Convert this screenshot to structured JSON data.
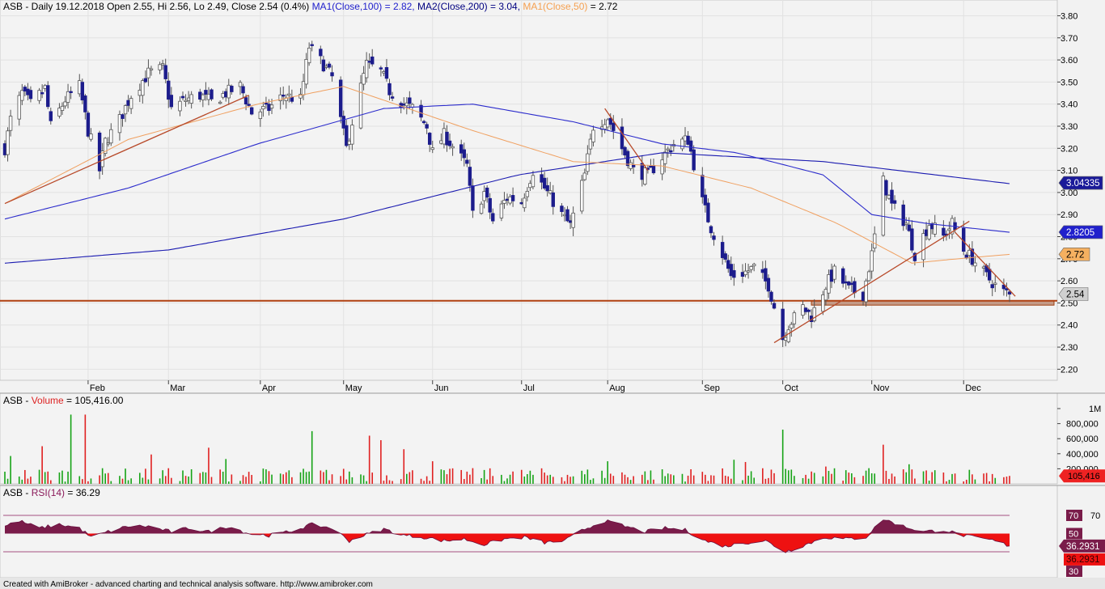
{
  "symbol": "ASB",
  "footer": "Created with AmiBroker - advanced charting and technical analysis software. http://www.amibroker.com",
  "colors": {
    "bull": "#16a316",
    "bear": "#e02020",
    "candle_bear": "#1c1c8c",
    "candle_bull_fill": "#ffffff",
    "ma100": "#2c2ccc",
    "ma200": "#f0a050",
    "ma50": "#f5a050",
    "rsi_up": "#7a1c4a",
    "rsi_down": "#ee1111",
    "trendline": "#b84a2a",
    "support": "#b04010"
  },
  "price_panel": {
    "title_parts": [
      {
        "text": "ASB - Daily 19.12.2018 Open 2.55, Hi 2.56, Lo 2.49, Close 2.54 (0.4%) ",
        "color": "#000000"
      },
      {
        "text": "MA1(Close,100) = 2.82, ",
        "color": "#2020cc"
      },
      {
        "text": "MA2(Close,200) = 3.04, ",
        "color": "#000080"
      },
      {
        "text": "MA1(Close,50)",
        "color": "#f5a050"
      },
      {
        "text": " = 2.72",
        "color": "#000000"
      }
    ],
    "y_ticks": [
      "3.80",
      "3.70",
      "3.60",
      "3.50",
      "3.40",
      "3.30",
      "3.20",
      "3.10",
      "3.00",
      "2.90",
      "2.80",
      "2.70",
      "2.60",
      "2.50",
      "2.40",
      "2.30",
      "2.20"
    ],
    "markers": [
      {
        "label": "3.04335",
        "value": 3.04335,
        "bg": "#1a1a99",
        "fg": "#ffffff"
      },
      {
        "label": "2.8205",
        "value": 2.8205,
        "bg": "#2020cc",
        "fg": "#ffffff"
      },
      {
        "label": "2.72",
        "value": 2.72,
        "bg": "#f5b060",
        "fg": "#000000"
      },
      {
        "label": "2.54",
        "value": 2.54,
        "bg": "#d0d0d0",
        "fg": "#000000"
      }
    ],
    "months": [
      "Feb",
      "Mar",
      "Apr",
      "May",
      "Jun",
      "Jul",
      "Aug",
      "Sep",
      "Oct",
      "Nov",
      "Dec"
    ]
  },
  "volume_panel": {
    "title_parts": [
      {
        "text": "ASB - ",
        "color": "#000000"
      },
      {
        "text": "Volume",
        "color": "#dd2222"
      },
      {
        "text": " = 105,416.00",
        "color": "#000000"
      }
    ],
    "y_ticks": [
      "1M",
      "800,000",
      "600,000",
      "400,000",
      "200,000"
    ],
    "marker": {
      "label": "105,416",
      "bg": "#ee2222",
      "fg": "#000000"
    }
  },
  "rsi_panel": {
    "title_parts": [
      {
        "text": "ASB - ",
        "color": "#000000"
      },
      {
        "text": "RSI(14)",
        "color": "#8a1a5a"
      },
      {
        "text": " = 36.29",
        "color": "#000000"
      }
    ],
    "levels": [
      "70",
      "50",
      "30"
    ],
    "tick_70": "70",
    "marker_top": "36.2931",
    "marker_bottom": "36.2931"
  },
  "chart_data": {
    "type": "candlestick",
    "title": "ASB - Daily 19.12.2018 Open 2.55, Hi 2.56, Lo 2.49, Close 2.54 (0.4%)",
    "ylim": [
      2.15,
      3.82
    ],
    "support_level": 2.51,
    "support_zone": [
      2.49,
      2.51
    ],
    "price_anchors": [
      [
        "2018-01-03",
        3.2
      ],
      [
        "2018-01-05",
        3.33
      ],
      [
        "2018-01-09",
        3.45
      ],
      [
        "2018-01-12",
        3.4
      ],
      [
        "2018-01-17",
        3.47
      ],
      [
        "2018-01-19",
        3.3
      ],
      [
        "2018-01-24",
        3.42
      ],
      [
        "2018-01-29",
        3.48
      ],
      [
        "2018-02-01",
        3.28
      ],
      [
        "2018-02-05",
        3.1
      ],
      [
        "2018-02-07",
        3.23
      ],
      [
        "2018-02-12",
        3.33
      ],
      [
        "2018-02-16",
        3.44
      ],
      [
        "2018-02-22",
        3.54
      ],
      [
        "2018-02-27",
        3.56
      ],
      [
        "2018-03-02",
        3.38
      ],
      [
        "2018-03-07",
        3.42
      ],
      [
        "2018-03-12",
        3.44
      ],
      [
        "2018-03-16",
        3.41
      ],
      [
        "2018-03-21",
        3.45
      ],
      [
        "2018-03-26",
        3.48
      ],
      [
        "2018-03-30",
        3.36
      ],
      [
        "2018-04-05",
        3.38
      ],
      [
        "2018-04-10",
        3.44
      ],
      [
        "2018-04-16",
        3.42
      ],
      [
        "2018-04-19",
        3.66
      ],
      [
        "2018-04-24",
        3.58
      ],
      [
        "2018-04-27",
        3.52
      ],
      [
        "2018-05-02",
        3.2
      ],
      [
        "2018-05-04",
        3.32
      ],
      [
        "2018-05-09",
        3.58
      ],
      [
        "2018-05-14",
        3.55
      ],
      [
        "2018-05-17",
        3.46
      ],
      [
        "2018-05-22",
        3.4
      ],
      [
        "2018-05-25",
        3.38
      ],
      [
        "2018-05-30",
        3.3
      ],
      [
        "2018-06-01",
        3.18
      ],
      [
        "2018-06-05",
        3.26
      ],
      [
        "2018-06-08",
        3.21
      ],
      [
        "2018-06-13",
        3.12
      ],
      [
        "2018-06-15",
        2.9
      ],
      [
        "2018-06-19",
        3.0
      ],
      [
        "2018-06-22",
        2.87
      ],
      [
        "2018-06-27",
        2.98
      ],
      [
        "2018-07-02",
        2.96
      ],
      [
        "2018-07-06",
        3.1
      ],
      [
        "2018-07-11",
        3.0
      ],
      [
        "2018-07-16",
        2.9
      ],
      [
        "2018-07-19",
        2.85
      ],
      [
        "2018-07-24",
        3.08
      ],
      [
        "2018-07-27",
        3.3
      ],
      [
        "2018-08-01",
        3.34
      ],
      [
        "2018-08-06",
        3.2
      ],
      [
        "2018-08-10",
        3.1
      ],
      [
        "2018-08-15",
        3.08
      ],
      [
        "2018-08-20",
        3.16
      ],
      [
        "2018-08-24",
        3.22
      ],
      [
        "2018-08-29",
        3.24
      ],
      [
        "2018-09-03",
        2.96
      ],
      [
        "2018-09-06",
        2.84
      ],
      [
        "2018-09-10",
        2.72
      ],
      [
        "2018-09-13",
        2.62
      ],
      [
        "2018-09-18",
        2.64
      ],
      [
        "2018-09-21",
        2.66
      ],
      [
        "2018-09-26",
        2.58
      ],
      [
        "2018-10-01",
        2.34
      ],
      [
        "2018-10-03",
        2.4
      ],
      [
        "2018-10-08",
        2.48
      ],
      [
        "2018-10-11",
        2.44
      ],
      [
        "2018-10-16",
        2.58
      ],
      [
        "2018-10-19",
        2.64
      ],
      [
        "2018-10-24",
        2.56
      ],
      [
        "2018-10-29",
        2.54
      ],
      [
        "2018-11-01",
        2.72
      ],
      [
        "2018-11-05",
        3.05
      ],
      [
        "2018-11-08",
        2.94
      ],
      [
        "2018-11-13",
        2.86
      ],
      [
        "2018-11-16",
        2.72
      ],
      [
        "2018-11-21",
        2.86
      ],
      [
        "2018-11-26",
        2.8
      ],
      [
        "2018-11-29",
        2.86
      ],
      [
        "2018-12-03",
        2.74
      ],
      [
        "2018-12-06",
        2.7
      ],
      [
        "2018-12-11",
        2.62
      ],
      [
        "2018-12-14",
        2.58
      ],
      [
        "2018-12-17",
        2.55
      ],
      [
        "2018-12-19",
        2.54
      ]
    ],
    "ma100_anchors": [
      [
        "2018-01-03",
        2.88
      ],
      [
        "2018-02-15",
        3.02
      ],
      [
        "2018-04-01",
        3.22
      ],
      [
        "2018-05-15",
        3.38
      ],
      [
        "2018-06-15",
        3.4
      ],
      [
        "2018-07-20",
        3.32
      ],
      [
        "2018-08-20",
        3.22
      ],
      [
        "2018-09-15",
        3.18
      ],
      [
        "2018-10-15",
        3.08
      ],
      [
        "2018-11-01",
        2.9
      ],
      [
        "2018-11-20",
        2.86
      ],
      [
        "2018-12-19",
        2.82
      ]
    ],
    "ma200_anchors": [
      [
        "2018-01-03",
        2.68
      ],
      [
        "2018-03-01",
        2.74
      ],
      [
        "2018-05-01",
        2.88
      ],
      [
        "2018-07-01",
        3.08
      ],
      [
        "2018-08-20",
        3.18
      ],
      [
        "2018-10-15",
        3.14
      ],
      [
        "2018-12-19",
        3.04
      ]
    ],
    "ma50_anchors": [
      [
        "2018-01-03",
        2.95
      ],
      [
        "2018-02-15",
        3.24
      ],
      [
        "2018-04-01",
        3.4
      ],
      [
        "2018-05-01",
        3.48
      ],
      [
        "2018-06-15",
        3.28
      ],
      [
        "2018-07-20",
        3.14
      ],
      [
        "2018-08-20",
        3.12
      ],
      [
        "2018-09-20",
        3.02
      ],
      [
        "2018-10-20",
        2.86
      ],
      [
        "2018-11-15",
        2.68
      ],
      [
        "2018-12-01",
        2.7
      ],
      [
        "2018-12-19",
        2.72
      ]
    ],
    "trendlines": [
      [
        [
          "2018-01-03",
          2.95
        ],
        [
          "2018-03-29",
          3.44
        ]
      ],
      [
        [
          "2018-07-31",
          3.38
        ],
        [
          "2018-08-15",
          3.1
        ]
      ],
      [
        [
          "2018-09-28",
          2.32
        ],
        [
          "2018-12-05",
          2.87
        ]
      ],
      [
        [
          "2018-11-30",
          2.82
        ],
        [
          "2018-12-21",
          2.53
        ]
      ]
    ],
    "volume_max": 1000000,
    "volume_spikes": [
      [
        "2018-01-26",
        920000,
        "up"
      ],
      [
        "2018-01-31",
        920000,
        "down"
      ],
      [
        "2018-01-16",
        500000,
        "down"
      ],
      [
        "2018-01-05",
        370000,
        "up"
      ],
      [
        "2018-04-20",
        700000,
        "up"
      ],
      [
        "2018-05-10",
        640000,
        "down"
      ],
      [
        "2018-05-14",
        580000,
        "down"
      ],
      [
        "2018-05-22",
        460000,
        "down"
      ],
      [
        "2018-03-15",
        480000,
        "down"
      ],
      [
        "2018-02-23",
        390000,
        "down"
      ],
      [
        "2018-03-21",
        330000,
        "up"
      ],
      [
        "2018-10-01",
        720000,
        "up"
      ],
      [
        "2018-11-05",
        520000,
        "down"
      ],
      [
        "2018-09-14",
        320000,
        "up"
      ],
      [
        "2018-09-18",
        290000,
        "down"
      ],
      [
        "2018-06-01",
        300000,
        "down"
      ],
      [
        "2018-08-01",
        300000,
        "up"
      ],
      [
        "2018-11-14",
        260000,
        "up"
      ],
      [
        "2018-10-16",
        230000,
        "down"
      ],
      [
        "2018-12-19",
        105416,
        "down"
      ]
    ],
    "volume_last": 105416,
    "rsi_last": 36.29,
    "rsi_anchors": [
      [
        "2018-01-03",
        58
      ],
      [
        "2018-01-08",
        64
      ],
      [
        "2018-01-15",
        56
      ],
      [
        "2018-01-22",
        60
      ],
      [
        "2018-01-29",
        56
      ],
      [
        "2018-02-02",
        46
      ],
      [
        "2018-02-08",
        52
      ],
      [
        "2018-02-15",
        58
      ],
      [
        "2018-02-22",
        58
      ],
      [
        "2018-03-02",
        52
      ],
      [
        "2018-03-08",
        56
      ],
      [
        "2018-03-15",
        52
      ],
      [
        "2018-03-22",
        58
      ],
      [
        "2018-03-29",
        50
      ],
      [
        "2018-04-05",
        48
      ],
      [
        "2018-04-12",
        52
      ],
      [
        "2018-04-20",
        60
      ],
      [
        "2018-04-27",
        56
      ],
      [
        "2018-05-03",
        42
      ],
      [
        "2018-05-08",
        48
      ],
      [
        "2018-05-15",
        55
      ],
      [
        "2018-05-22",
        48
      ],
      [
        "2018-05-29",
        46
      ],
      [
        "2018-06-05",
        42
      ],
      [
        "2018-06-12",
        44
      ],
      [
        "2018-06-19",
        38
      ],
      [
        "2018-06-26",
        44
      ],
      [
        "2018-07-03",
        46
      ],
      [
        "2018-07-10",
        40
      ],
      [
        "2018-07-17",
        42
      ],
      [
        "2018-07-24",
        55
      ],
      [
        "2018-07-31",
        64
      ],
      [
        "2018-08-07",
        58
      ],
      [
        "2018-08-14",
        52
      ],
      [
        "2018-08-21",
        56
      ],
      [
        "2018-08-28",
        54
      ],
      [
        "2018-09-04",
        42
      ],
      [
        "2018-09-11",
        36
      ],
      [
        "2018-09-18",
        40
      ],
      [
        "2018-09-25",
        42
      ],
      [
        "2018-10-02",
        30
      ],
      [
        "2018-10-09",
        38
      ],
      [
        "2018-10-16",
        46
      ],
      [
        "2018-10-23",
        44
      ],
      [
        "2018-10-30",
        46
      ],
      [
        "2018-11-05",
        66
      ],
      [
        "2018-11-12",
        58
      ],
      [
        "2018-11-19",
        52
      ],
      [
        "2018-11-26",
        54
      ],
      [
        "2018-12-03",
        48
      ],
      [
        "2018-12-10",
        44
      ],
      [
        "2018-12-14",
        42
      ],
      [
        "2018-12-19",
        36.29
      ]
    ]
  }
}
